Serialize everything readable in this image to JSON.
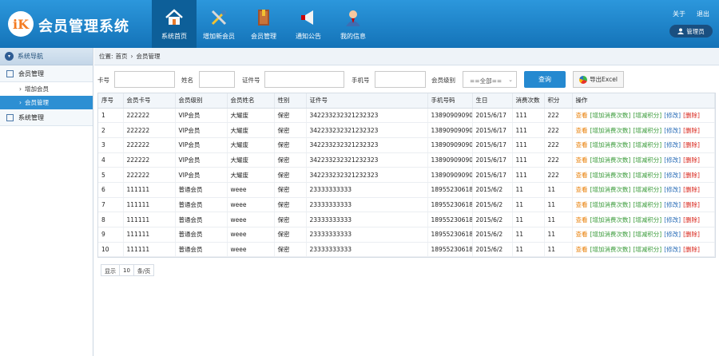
{
  "app": {
    "logo_text": "iK",
    "title": "会员管理系统"
  },
  "nav": [
    {
      "label": "系统首页",
      "icon": "home-icon",
      "active": true
    },
    {
      "label": "增加新会员",
      "icon": "tools-icon",
      "active": false
    },
    {
      "label": "会员管理",
      "icon": "book-icon",
      "active": false
    },
    {
      "label": "通知公告",
      "icon": "megaphone-icon",
      "active": false
    },
    {
      "label": "我的信息",
      "icon": "user-icon",
      "active": false
    }
  ],
  "header": {
    "about": "关于",
    "logout": "退出",
    "admin": "管理员"
  },
  "sidebar": {
    "title": "系统导航",
    "group1": "会员管理",
    "items": [
      "增加会员",
      "会员管理"
    ],
    "group2": "系统管理"
  },
  "breadcrumb": {
    "label": "位置:",
    "home": "首页",
    "sep": "›",
    "current": "会员管理"
  },
  "search": {
    "card_label": "卡号",
    "name_label": "姓名",
    "id_label": "证件号",
    "phone_label": "手机号",
    "level_label": "会员级别",
    "level_value": "==全部==",
    "query_button": "查询",
    "export_button": "导出Excel"
  },
  "table": {
    "headers": [
      "序号",
      "会员卡号",
      "会员级别",
      "会员姓名",
      "性别",
      "证件号",
      "手机号码",
      "生日",
      "消费次数",
      "积分",
      "操作"
    ],
    "ops": {
      "view": "查看",
      "add_times": "[增加消费次数]",
      "add_points": "[增减积分]",
      "edit": "[修改]",
      "delete": "[删除]"
    },
    "rows": [
      [
        "1",
        "222222",
        "VIP会员",
        "大耀废",
        "保密",
        "342233232321232323",
        "13890909090",
        "2015/6/17",
        "111",
        "222"
      ],
      [
        "2",
        "222222",
        "VIP会员",
        "大耀废",
        "保密",
        "342233232321232323",
        "13890909090",
        "2015/6/17",
        "111",
        "222"
      ],
      [
        "3",
        "222222",
        "VIP会员",
        "大耀废",
        "保密",
        "342233232321232323",
        "13890909090",
        "2015/6/17",
        "111",
        "222"
      ],
      [
        "4",
        "222222",
        "VIP会员",
        "大耀废",
        "保密",
        "342233232321232323",
        "13890909090",
        "2015/6/17",
        "111",
        "222"
      ],
      [
        "5",
        "222222",
        "VIP会员",
        "大耀废",
        "保密",
        "342233232321232323",
        "13890909090",
        "2015/6/17",
        "111",
        "222"
      ],
      [
        "6",
        "111111",
        "普通会员",
        "weee",
        "保密",
        "23333333333",
        "18955230618",
        "2015/6/2",
        "11",
        "11"
      ],
      [
        "7",
        "111111",
        "普通会员",
        "weee",
        "保密",
        "23333333333",
        "18955230618",
        "2015/6/2",
        "11",
        "11"
      ],
      [
        "8",
        "111111",
        "普通会员",
        "weee",
        "保密",
        "23333333333",
        "18955230618",
        "2015/6/2",
        "11",
        "11"
      ],
      [
        "9",
        "111111",
        "普通会员",
        "weee",
        "保密",
        "23333333333",
        "18955230618",
        "2015/6/2",
        "11",
        "11"
      ],
      [
        "10",
        "111111",
        "普通会员",
        "weee",
        "保密",
        "23333333333",
        "18955230618",
        "2015/6/2",
        "11",
        "11"
      ]
    ]
  },
  "pager": {
    "show": "显示",
    "size": "10",
    "per_page": "条/页"
  }
}
